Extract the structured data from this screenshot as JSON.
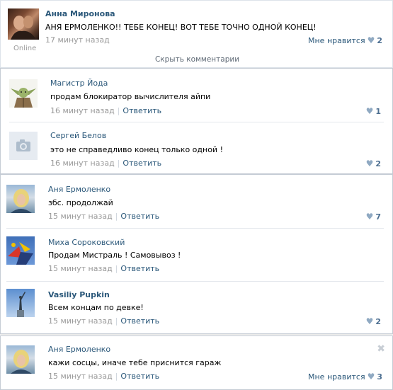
{
  "post": {
    "author": "Анна Миронова",
    "online": "Online",
    "text": "АНЯ ЕРМОЛЕНКО!! ТЕБЕ КОНЕЦ! ВОТ ТЕБЕ ТОЧНО ОДНОЙ КОНЕЦ!",
    "time": "17 минут назад",
    "like_label": "Мне нравится",
    "like_count": "2",
    "hide_comments": "Скрыть комментарии"
  },
  "comments": [
    {
      "author": "Магистр Йода",
      "text": "продам блокиратор вычислителя айпи",
      "time": "16 минут назад",
      "reply": "Ответить",
      "likes": "1"
    },
    {
      "author": "Сергей Белов",
      "text": "это не справедливо конец только одной !",
      "time": "16 минут назад",
      "reply": "Ответить",
      "likes": "2"
    },
    {
      "author": "Аня Ермоленко",
      "text": "збс. продолжай",
      "time": "15 минут назад",
      "reply": "Ответить",
      "likes": "7"
    },
    {
      "author": "Миха Сороковский",
      "text": "Продам Мистраль ! Самовывоз !",
      "time": "15 минут назад",
      "reply": "Ответить",
      "likes": ""
    },
    {
      "author": "Vasiliy Pupkin",
      "text": "Всем концам по девке!",
      "time": "15 минут назад",
      "reply": "Ответить",
      "likes": "2"
    },
    {
      "author": "Аня Ермоленко",
      "text": "кажи сосцы, иначе тебе приснится гараж",
      "time": "15 минут назад",
      "reply": "Ответить",
      "like_label": "Мне нравится",
      "likes": "3"
    }
  ],
  "colors": {
    "link": "#2b587a",
    "muted": "#999999",
    "heart": "#8fa9c2",
    "count": "#4d6f91"
  }
}
